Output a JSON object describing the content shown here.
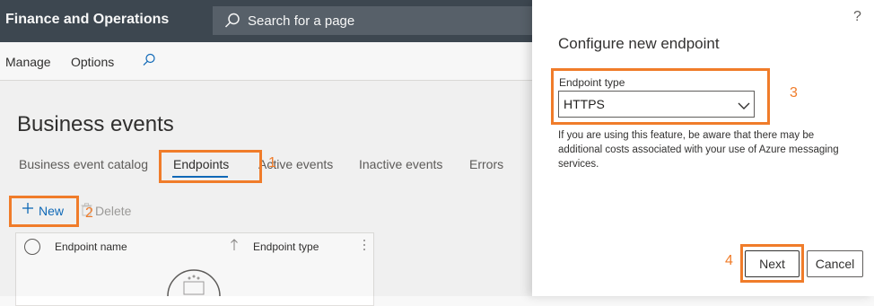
{
  "app": {
    "title": "Finance and Operations"
  },
  "search": {
    "placeholder": "Search for a page"
  },
  "actionbar": {
    "manage": "Manage",
    "options": "Options"
  },
  "page": {
    "title": "Business events"
  },
  "tabs": [
    {
      "label": "Business event catalog"
    },
    {
      "label": "Endpoints"
    },
    {
      "label": "Active events"
    },
    {
      "label": "Inactive events"
    },
    {
      "label": "Errors"
    }
  ],
  "toolbar": {
    "new_label": "New",
    "delete_label": "Delete"
  },
  "grid": {
    "columns": [
      {
        "label": "Endpoint name"
      },
      {
        "label": "Endpoint type"
      }
    ]
  },
  "panel": {
    "help": "?",
    "title": "Configure new endpoint",
    "field_label": "Endpoint type",
    "field_value": "HTTPS",
    "notice": "If you are using this feature, be aware that there may be additional costs associated with your use of Azure messaging services.",
    "next_label": "Next",
    "cancel_label": "Cancel"
  },
  "callouts": {
    "step1": "1",
    "step2": "2",
    "step3": "3",
    "step4": "4"
  },
  "colors": {
    "accent": "#0f6cbd",
    "callout": "#f07c2a",
    "topbar": "#3f4a53"
  }
}
